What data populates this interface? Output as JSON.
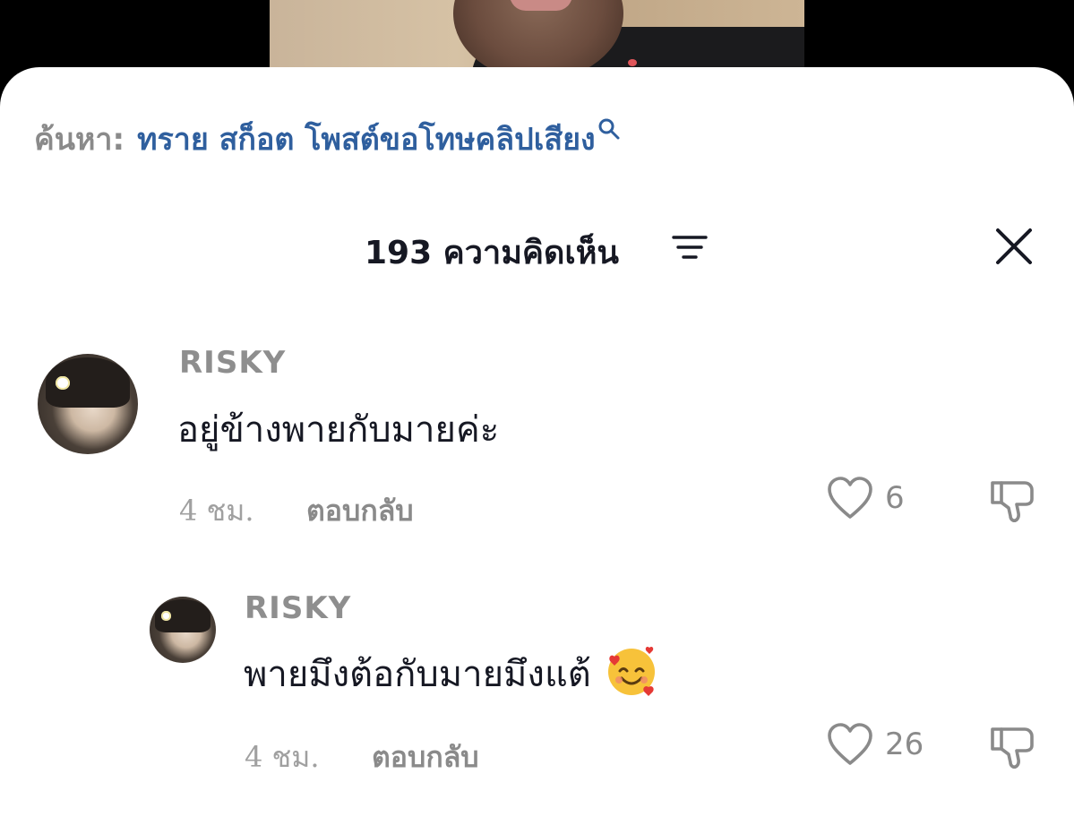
{
  "search": {
    "prefix": "ค้นหา:",
    "query": "ทราย สก็อต โพสต์ขอโทษคลิปเสียง"
  },
  "header": {
    "comment_count": "193 ความคิดเห็น"
  },
  "comments": [
    {
      "username": "RISKY",
      "text": "อยู่ข้างพายกับมายค่ะ",
      "time": "4 ชม.",
      "reply_label": "ตอบกลับ",
      "likes": "6"
    }
  ],
  "replies": [
    {
      "username": "RISKY",
      "text": "พายมึงต้อกับมายมึงแต้",
      "emoji": "smiling-face-with-hearts",
      "time": "4 ชม.",
      "reply_label": "ตอบกลับ",
      "likes": "26"
    }
  ],
  "colors": {
    "query_blue": "#2f5f9e",
    "text_primary": "#161823",
    "text_muted": "#8a8a8a"
  }
}
